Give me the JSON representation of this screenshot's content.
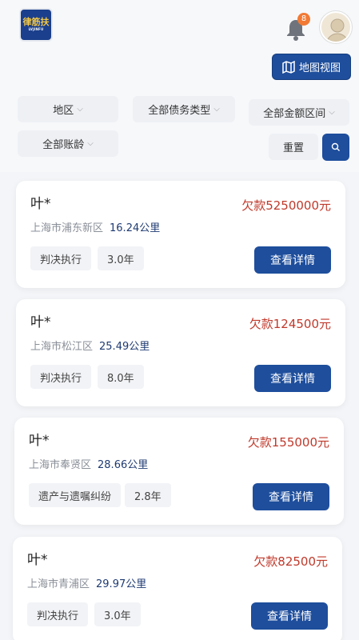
{
  "header": {
    "logo_text": "律筋扶",
    "logo_sub": "LVJINFU",
    "notification_count": "8",
    "map_view_label": "地图视图"
  },
  "filters": {
    "region": "地区",
    "debt_type": "全部债务类型",
    "amount_range": "全部金额区间",
    "age": "全部账龄",
    "reset_label": "重置"
  },
  "cases": [
    {
      "name": "叶*",
      "debt": "欠款5250000元",
      "location": "上海市浦东新区",
      "distance": "16.24公里",
      "type": "判决执行",
      "age": "3.0年",
      "detail_label": "查看详情"
    },
    {
      "name": "叶*",
      "debt": "欠款124500元",
      "location": "上海市松江区",
      "distance": "25.49公里",
      "type": "判决执行",
      "age": "8.0年",
      "detail_label": "查看详情"
    },
    {
      "name": "叶*",
      "debt": "欠款155000元",
      "location": "上海市奉贤区",
      "distance": "28.66公里",
      "type": "遗产与遗嘱纠纷",
      "age": "2.8年",
      "detail_label": "查看详情"
    },
    {
      "name": "叶*",
      "debt": "欠款82500元",
      "location": "上海市青浦区",
      "distance": "29.97公里",
      "type": "判决执行",
      "age": "3.0年",
      "detail_label": "查看详情"
    }
  ],
  "colors": {
    "primary": "#1e4e9c",
    "debt": "#c0392b",
    "badge": "#f27a35"
  }
}
